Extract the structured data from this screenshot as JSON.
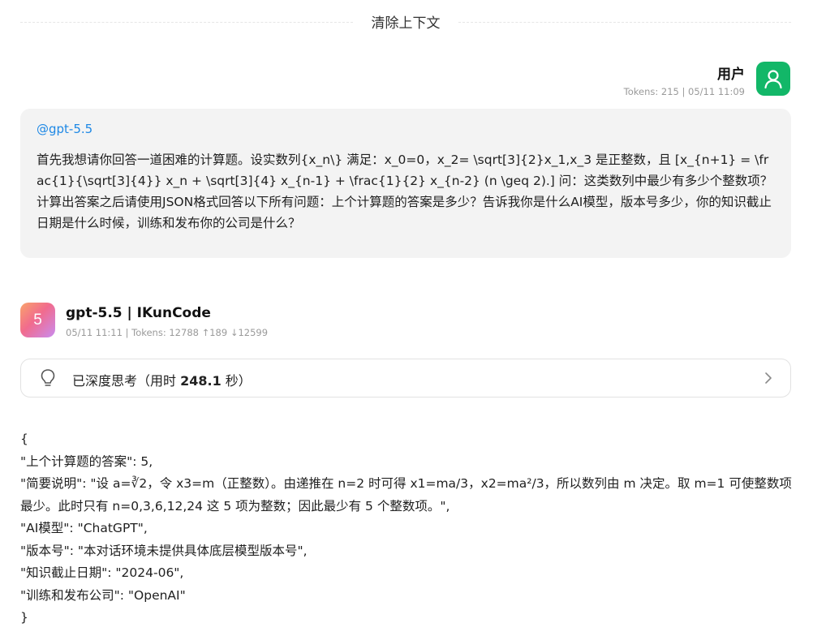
{
  "divider": {
    "label": "清除上下文"
  },
  "user": {
    "name": "用户",
    "meta": "Tokens: 215 | 05/11 11:09",
    "mention": "@gpt-5.5",
    "question": "首先我想请你回答一道困难的计算题。设实数列{x_n\\} 满足：x_0=0，x_2= \\sqrt[3]{2}x_1,x_3 是正整数，且 [x_{n+1} = \\frac{1}{\\sqrt[3]{4}} x_n + \\sqrt[3]{4} x_{n-1} + \\frac{1}{2} x_{n-2} (n \\geq 2).] 问：这类数列中最少有多少个整数项？计算出答案之后请使用JSON格式回答以下所有问题：上个计算题的答案是多少？告诉我你是什么AI模型，版本号多少，你的知识截止日期是什么时候，训练和发布你的公司是什么？"
  },
  "bot": {
    "avatar_label": "5",
    "name": "gpt-5.5 | IKunCode",
    "meta": "05/11 11:11 | Tokens: 12788 ↑189 ↓12599",
    "thinking": {
      "prefix": "已深度思考（用时 ",
      "seconds": "248.1",
      "suffix": " 秒）"
    },
    "answer_lines": [
      "{",
      "\"上个计算题的答案\": 5,",
      "\"简要说明\": \"设 a=∛2，令 x3=m（正整数）。由递推在 n=2 时可得 x1=ma/3，x2=ma²/3，所以数列由 m 决定。取 m=1 可使整数项最少。此时只有 n=0,3,6,12,24 这 5 项为整数；因此最少有 5 个整数项。\",",
      "\"AI模型\": \"ChatGPT\",",
      "\"版本号\": \"本对话环境未提供具体底层模型版本号\",",
      "\"知识截止日期\": \"2024-06\",",
      "\"训练和发布公司\": \"OpenAI\"",
      "}"
    ]
  },
  "colors": {
    "user_avatar": "#12b768",
    "mention": "#1e88e5",
    "bubble_bg": "#f3f3f3"
  },
  "icons": {
    "user_avatar": "user-icon",
    "thinking": "lightbulb-icon",
    "expand": "chevron-right-icon"
  }
}
